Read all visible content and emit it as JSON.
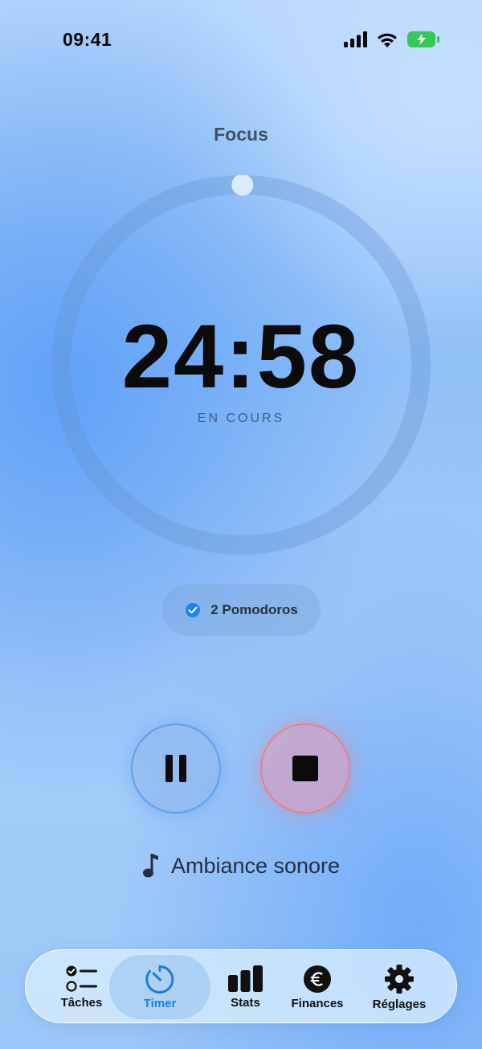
{
  "status_bar": {
    "time": "09:41"
  },
  "timer": {
    "mode": "Focus",
    "time": "24:58",
    "status": "EN COURS",
    "progress": 0.0013
  },
  "pomodoro": {
    "label": "2 Pomodoros"
  },
  "controls": {
    "pause_icon": "pause-icon",
    "stop_icon": "stop-icon"
  },
  "ambiance": {
    "label": "Ambiance sonore",
    "icon": "music-note-icon"
  },
  "tabs": [
    {
      "label": "Tâches",
      "icon": "checklist-icon",
      "active": false
    },
    {
      "label": "Timer",
      "icon": "timer-icon",
      "active": true
    },
    {
      "label": "Stats",
      "icon": "bar-chart-icon",
      "active": false
    },
    {
      "label": "Finances",
      "icon": "euro-icon",
      "active": false
    },
    {
      "label": "Réglages",
      "icon": "gear-icon",
      "active": false
    }
  ],
  "colors": {
    "accent": "#1b7fe0",
    "stop": "#ee7f86",
    "battery": "#34c759"
  }
}
